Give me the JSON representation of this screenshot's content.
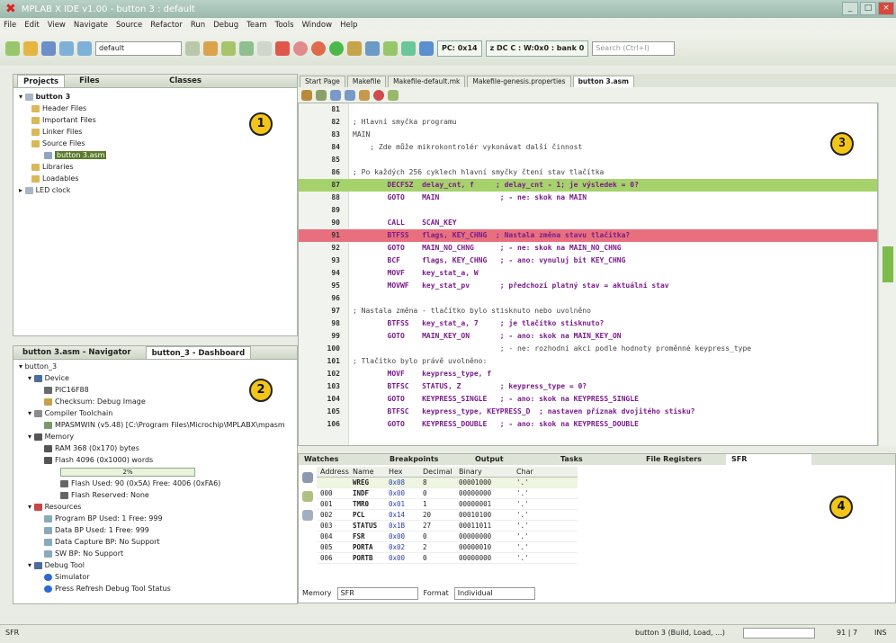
{
  "window": {
    "title": "MPLAB X IDE v1.00 - button 3 : default"
  },
  "menu": [
    "File",
    "Edit",
    "View",
    "Navigate",
    "Source",
    "Refactor",
    "Run",
    "Debug",
    "Team",
    "Tools",
    "Window",
    "Help"
  ],
  "toolbar": {
    "config": "default",
    "pc": "PC: 0x14",
    "wreg": "z DC C : W:0x0 : bank 0",
    "search_placeholder": "Search (Ctrl+I)"
  },
  "projects": {
    "tabs": [
      "Projects",
      "Files",
      "Classes"
    ],
    "tree": [
      "button 3",
      "Header Files",
      "Important Files",
      "Linker Files",
      "Source Files",
      "button 3.asm",
      "Libraries",
      "Loadables",
      "LED clock"
    ]
  },
  "dashboard": {
    "tabs": [
      "button 3.asm - Navigator",
      "button_3 - Dashboard"
    ],
    "tree": [
      "button_3",
      "Device",
      "PIC16F88",
      "Checksum: Debug Image",
      "Compiler Toolchain",
      "MPASMWIN (v5.48) [C:\\Program Files\\Microchip\\MPLABX\\mpasm",
      "Memory",
      "RAM 368 (0x170) bytes",
      "Flash 4096 (0x1000) words",
      "2%",
      "Flash Used: 90 (0x5A) Free: 4006 (0xFA6)",
      "Flash Reserved: None",
      "Resources",
      "Program BP Used: 1 Free: 999",
      "Data BP Used: 1 Free: 999",
      "Data Capture BP: No Support",
      "SW BP: No Support",
      "Debug Tool",
      "Simulator",
      "Press Refresh Debug Tool Status"
    ]
  },
  "editor": {
    "tabs": [
      "Start Page",
      "Makefile",
      "Makefile-default.mk",
      "Makefile-genesis.properties",
      "button 3.asm"
    ],
    "lines": [
      {
        "n": "81",
        "t": ""
      },
      {
        "n": "82",
        "t": "; Hlavní smyčka programu"
      },
      {
        "n": "83",
        "t": "MAIN"
      },
      {
        "n": "84",
        "t": "    ; Zde může mikrokontrolér vykonávat další činnost"
      },
      {
        "n": "85",
        "t": ""
      },
      {
        "n": "86",
        "t": "; Po každých 256 cyklech hlavní smyčky čtení stav tlačítka"
      },
      {
        "n": "87",
        "t": "        DECFSZ  delay_cnt, f     ; delay_cnt - 1; je výsledek = 0?"
      },
      {
        "n": "88",
        "t": "        GOTO    MAIN              ; - ne: skok na MAIN"
      },
      {
        "n": "89",
        "t": ""
      },
      {
        "n": "90",
        "t": "        CALL    SCAN_KEY"
      },
      {
        "n": "91",
        "t": "        BTFSS   flags, KEY_CHNG  ; Nastala změna stavu tlačítka?"
      },
      {
        "n": "92",
        "t": "        GOTO    MAIN_NO_CHNG      ; - ne: skok na MAIN_NO_CHNG"
      },
      {
        "n": "93",
        "t": "        BCF     flags, KEY_CHNG   ; - ano: vynuluj bit KEY_CHNG"
      },
      {
        "n": "94",
        "t": "        MOVF    key_stat_a, W"
      },
      {
        "n": "95",
        "t": "        MOVWF   key_stat_pv       ; předchozí platný stav = aktuální stav"
      },
      {
        "n": "96",
        "t": ""
      },
      {
        "n": "97",
        "t": "; Nastala změna - tlačítko bylo stisknuto nebo uvolněno"
      },
      {
        "n": "98",
        "t": "        BTFSS   key_stat_a, 7     ; je tlačítko stisknuto?"
      },
      {
        "n": "99",
        "t": "        GOTO    MAIN_KEY_ON       ; - ano: skok na MAIN_KEY_ON"
      },
      {
        "n": "100",
        "t": "                                  ; - ne: rozhodni akci podle hodnoty proměnné keypress_type"
      },
      {
        "n": "101",
        "t": "; Tlačítko bylo právě uvolněno:"
      },
      {
        "n": "102",
        "t": "        MOVF    keypress_type, f"
      },
      {
        "n": "103",
        "t": "        BTFSC   STATUS, Z         ; keypress_type = 0?"
      },
      {
        "n": "104",
        "t": "        GOTO    KEYPRESS_SINGLE   ; - ano: skok na KEYPRESS_SINGLE"
      },
      {
        "n": "105",
        "t": "        BTFSC   keypress_type, KEYPRESS_D  ; nastaven příznak dvojitého stisku?"
      },
      {
        "n": "106",
        "t": "        GOTO    KEYPRESS_DOUBLE   ; - ano: skok na KEYPRESS_DOUBLE"
      }
    ]
  },
  "watches": {
    "tabs": [
      "Watches",
      "Breakpoints",
      "Output",
      "Tasks",
      "File Registers",
      "SFR"
    ],
    "columns": [
      "Address",
      "Name",
      "Hex",
      "Decimal",
      "Binary",
      "Char"
    ],
    "rows": [
      [
        "",
        "WREG",
        "0x08",
        "8",
        "00001000",
        "'.'"
      ],
      [
        "000",
        "INDF",
        "0x00",
        "0",
        "00000000",
        "'.'"
      ],
      [
        "001",
        "TMR0",
        "0x01",
        "1",
        "00000001",
        "'.'"
      ],
      [
        "002",
        "PCL",
        "0x14",
        "20",
        "00010100",
        "'.'"
      ],
      [
        "003",
        "STATUS",
        "0x1B",
        "27",
        "00011011",
        "'.'"
      ],
      [
        "004",
        "FSR",
        "0x00",
        "0",
        "00000000",
        "'.'"
      ],
      [
        "005",
        "PORTA",
        "0x02",
        "2",
        "00000010",
        "'.'"
      ],
      [
        "006",
        "PORTB",
        "0x00",
        "0",
        "00000000",
        "'.'"
      ]
    ],
    "memory_label": "Memory",
    "memory_value": "SFR",
    "format_label": "Format",
    "format_value": "Individual"
  },
  "callouts": [
    "1",
    "2",
    "3",
    "4"
  ],
  "status": {
    "left": "SFR",
    "build": "button 3 (Build, Load, ...)",
    "pos": "91 | 7",
    "ins": "INS"
  }
}
